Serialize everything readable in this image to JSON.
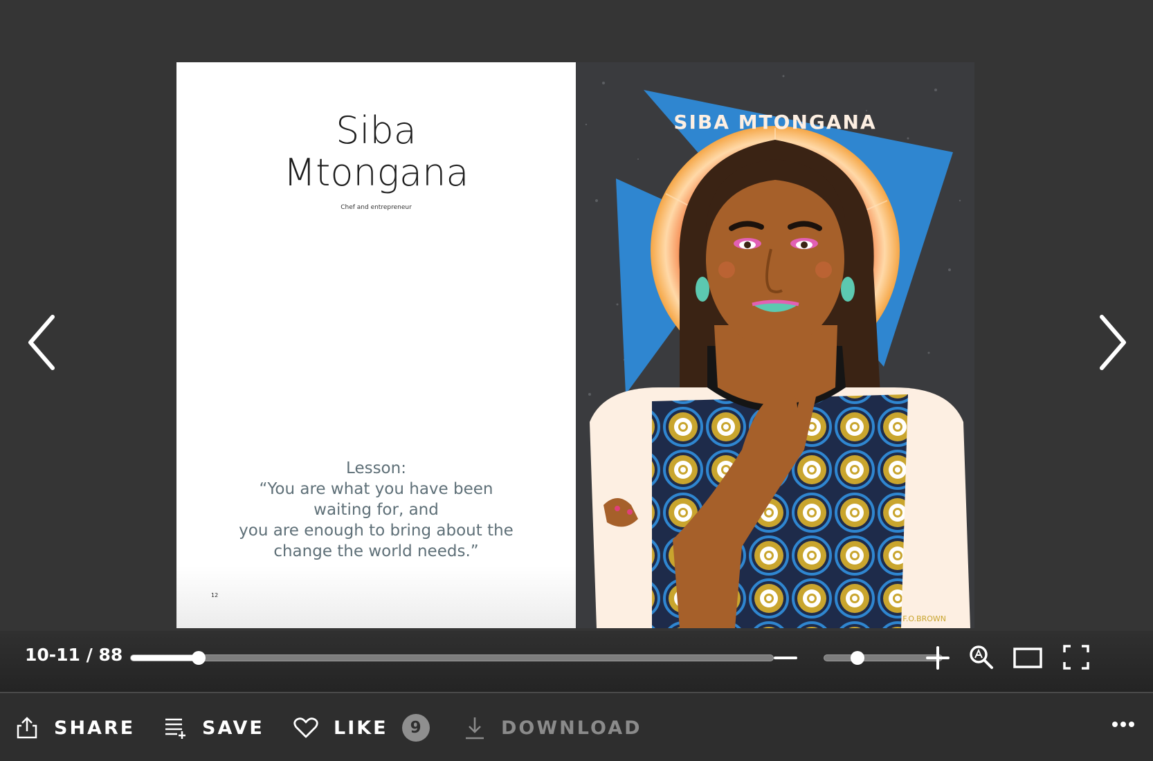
{
  "book": {
    "left_page": {
      "title_line1": "Siba",
      "title_line2": "Mtongana",
      "subtitle": "Chef and entrepreneur",
      "lesson_lines": [
        "Lesson:",
        "“You are what you have been",
        "waiting for, and",
        "you are enough to bring about the",
        "change the world needs.”"
      ],
      "page_number": "12"
    },
    "right_page": {
      "arched_name": "SIBA MTONGANA",
      "artist_signature": "F.O.BROWN"
    }
  },
  "navigation": {
    "prev_icon": "chevron-left-icon",
    "next_icon": "chevron-right-icon"
  },
  "controls": {
    "page_indicator": "10-11 / 88",
    "progress_fraction": 0.106,
    "zoom_fraction": 0.28,
    "icons": [
      "zoom-out-icon",
      "zoom-in-icon",
      "auto-zoom-icon",
      "single-page-view-icon",
      "fullscreen-icon"
    ]
  },
  "actions": {
    "share": "SHARE",
    "save": "SAVE",
    "like": "LIKE",
    "like_count": "9",
    "download": "DOWNLOAD",
    "more_icon": "more-options-icon"
  },
  "colors": {
    "background": "#353535",
    "controls_bar": "#2e2e2e",
    "lesson_text": "#5e6f77",
    "artwork_background": "#3a3b3e",
    "artwork_blue": "#2f86d0",
    "disabled_text": "#8b8b8b"
  }
}
